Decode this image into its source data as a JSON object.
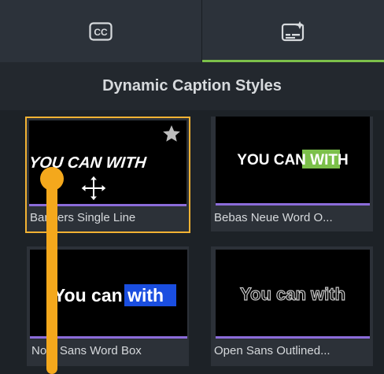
{
  "tabs": [
    {
      "icon": "cc-icon",
      "active": false
    },
    {
      "icon": "caption-style-icon",
      "active": true
    }
  ],
  "colors": {
    "accent": "#7cc04a",
    "selection": "#f2b233",
    "divider": "#8b6cd9",
    "highlight_green": "#7cc04a",
    "highlight_blue": "#1a4ee0"
  },
  "header": {
    "title": "Dynamic Caption Styles"
  },
  "styles": [
    {
      "name": "Bangers Single Line",
      "preview": "YOU CAN WITH",
      "favorite": true,
      "selected": true
    },
    {
      "name": "Bebas Neue Word O...",
      "preview_lead": "YOU CAN ",
      "preview_highlight": "WITH"
    },
    {
      "name": "Noto Sans Word Box",
      "preview_lead": "You can ",
      "preview_highlight": "with"
    },
    {
      "name": "Open Sans Outlined...",
      "preview": "You can with"
    }
  ]
}
